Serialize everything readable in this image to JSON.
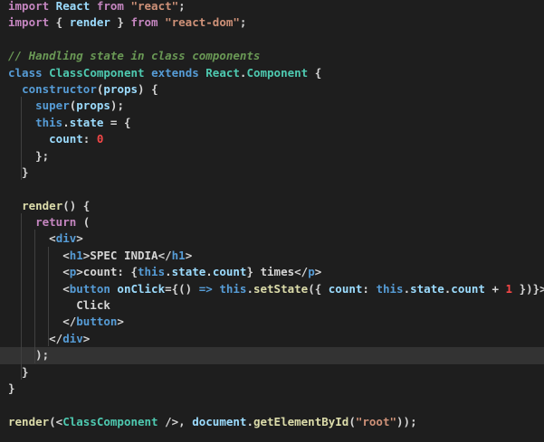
{
  "editor": {
    "lines": [
      [
        {
          "t": "import",
          "c": "kw2"
        },
        {
          "t": " React ",
          "c": "var"
        },
        {
          "t": "from",
          "c": "kw2"
        },
        {
          "t": " ",
          "c": "punc"
        },
        {
          "t": "\"react\"",
          "c": "str"
        },
        {
          "t": ";",
          "c": "punc"
        }
      ],
      [
        {
          "t": "import",
          "c": "kw2"
        },
        {
          "t": " { ",
          "c": "punc"
        },
        {
          "t": "render",
          "c": "var"
        },
        {
          "t": " } ",
          "c": "punc"
        },
        {
          "t": "from",
          "c": "kw2"
        },
        {
          "t": " ",
          "c": "punc"
        },
        {
          "t": "\"react-dom\"",
          "c": "str"
        },
        {
          "t": ";",
          "c": "punc"
        }
      ],
      [],
      [
        {
          "t": "// Handling state in class components",
          "c": "cmt"
        }
      ],
      [
        {
          "t": "class",
          "c": "kw"
        },
        {
          "t": " ",
          "c": "punc"
        },
        {
          "t": "ClassComponent",
          "c": "cls"
        },
        {
          "t": " ",
          "c": "punc"
        },
        {
          "t": "extends",
          "c": "kw"
        },
        {
          "t": " ",
          "c": "punc"
        },
        {
          "t": "React",
          "c": "cls"
        },
        {
          "t": ".",
          "c": "punc"
        },
        {
          "t": "Component",
          "c": "cls"
        },
        {
          "t": " {",
          "c": "punc"
        }
      ],
      [
        {
          "t": "  ",
          "c": "punc"
        },
        {
          "t": "constructor",
          "c": "kw"
        },
        {
          "t": "(",
          "c": "punc"
        },
        {
          "t": "props",
          "c": "var"
        },
        {
          "t": ") {",
          "c": "punc"
        }
      ],
      [
        {
          "t": "    ",
          "c": "punc"
        },
        {
          "t": "super",
          "c": "kw"
        },
        {
          "t": "(",
          "c": "punc"
        },
        {
          "t": "props",
          "c": "var"
        },
        {
          "t": ");",
          "c": "punc"
        }
      ],
      [
        {
          "t": "    ",
          "c": "punc"
        },
        {
          "t": "this",
          "c": "kw"
        },
        {
          "t": ".",
          "c": "punc"
        },
        {
          "t": "state",
          "c": "var"
        },
        {
          "t": " = {",
          "c": "punc"
        }
      ],
      [
        {
          "t": "      ",
          "c": "punc"
        },
        {
          "t": "count",
          "c": "var"
        },
        {
          "t": ": ",
          "c": "punc"
        },
        {
          "t": "0",
          "c": "num"
        }
      ],
      [
        {
          "t": "    };",
          "c": "punc"
        }
      ],
      [
        {
          "t": "  }",
          "c": "punc"
        }
      ],
      [],
      [
        {
          "t": "  ",
          "c": "punc"
        },
        {
          "t": "render",
          "c": "fn"
        },
        {
          "t": "() {",
          "c": "punc"
        }
      ],
      [
        {
          "t": "    ",
          "c": "punc"
        },
        {
          "t": "return",
          "c": "kw2"
        },
        {
          "t": " (",
          "c": "punc"
        }
      ],
      [
        {
          "t": "      <",
          "c": "punc"
        },
        {
          "t": "div",
          "c": "tag"
        },
        {
          "t": ">",
          "c": "punc"
        }
      ],
      [
        {
          "t": "        <",
          "c": "punc"
        },
        {
          "t": "h1",
          "c": "tag"
        },
        {
          "t": ">SPEC INDIA</",
          "c": "punc"
        },
        {
          "t": "h1",
          "c": "tag"
        },
        {
          "t": ">",
          "c": "punc"
        }
      ],
      [
        {
          "t": "        <",
          "c": "punc"
        },
        {
          "t": "p",
          "c": "tag"
        },
        {
          "t": ">count: {",
          "c": "punc"
        },
        {
          "t": "this",
          "c": "kw"
        },
        {
          "t": ".",
          "c": "punc"
        },
        {
          "t": "state",
          "c": "var"
        },
        {
          "t": ".",
          "c": "punc"
        },
        {
          "t": "count",
          "c": "var"
        },
        {
          "t": "} times</",
          "c": "punc"
        },
        {
          "t": "p",
          "c": "tag"
        },
        {
          "t": ">",
          "c": "punc"
        }
      ],
      [
        {
          "t": "        <",
          "c": "punc"
        },
        {
          "t": "button",
          "c": "tag"
        },
        {
          "t": " ",
          "c": "punc"
        },
        {
          "t": "onClick",
          "c": "attr"
        },
        {
          "t": "={() ",
          "c": "punc"
        },
        {
          "t": "=>",
          "c": "kw"
        },
        {
          "t": " ",
          "c": "punc"
        },
        {
          "t": "this",
          "c": "kw"
        },
        {
          "t": ".",
          "c": "punc"
        },
        {
          "t": "setState",
          "c": "fn"
        },
        {
          "t": "({ ",
          "c": "punc"
        },
        {
          "t": "count",
          "c": "var"
        },
        {
          "t": ": ",
          "c": "punc"
        },
        {
          "t": "this",
          "c": "kw"
        },
        {
          "t": ".",
          "c": "punc"
        },
        {
          "t": "state",
          "c": "var"
        },
        {
          "t": ".",
          "c": "punc"
        },
        {
          "t": "count",
          "c": "var"
        },
        {
          "t": " + ",
          "c": "punc"
        },
        {
          "t": "1",
          "c": "num"
        },
        {
          "t": " })}>",
          "c": "punc"
        }
      ],
      [
        {
          "t": "          Click",
          "c": "punc"
        }
      ],
      [
        {
          "t": "        </",
          "c": "punc"
        },
        {
          "t": "button",
          "c": "tag"
        },
        {
          "t": ">",
          "c": "punc"
        }
      ],
      [
        {
          "t": "      </",
          "c": "punc"
        },
        {
          "t": "div",
          "c": "tag"
        },
        {
          "t": ">",
          "c": "punc"
        }
      ],
      [
        {
          "t": "    );",
          "c": "punc"
        }
      ],
      [
        {
          "t": "  }",
          "c": "punc"
        }
      ],
      [
        {
          "t": "}",
          "c": "punc"
        }
      ],
      [],
      [
        {
          "t": "render",
          "c": "fn"
        },
        {
          "t": "(<",
          "c": "punc"
        },
        {
          "t": "ClassComponent",
          "c": "cls"
        },
        {
          "t": " />, ",
          "c": "punc"
        },
        {
          "t": "document",
          "c": "var"
        },
        {
          "t": ".",
          "c": "punc"
        },
        {
          "t": "getElementById",
          "c": "fn"
        },
        {
          "t": "(",
          "c": "punc"
        },
        {
          "t": "\"root\"",
          "c": "str"
        },
        {
          "t": "));",
          "c": "punc"
        }
      ]
    ],
    "highlighted_line": 21
  },
  "colors": {
    "background": "#1e1e1e",
    "current_line": "#333333",
    "keyword": "#569cd6",
    "control_keyword": "#c586c0",
    "string": "#ce9178",
    "comment": "#6a9955",
    "class": "#4ec9b0",
    "function": "#dcdcaa",
    "variable": "#9cdcfe",
    "number": "#f44747"
  }
}
